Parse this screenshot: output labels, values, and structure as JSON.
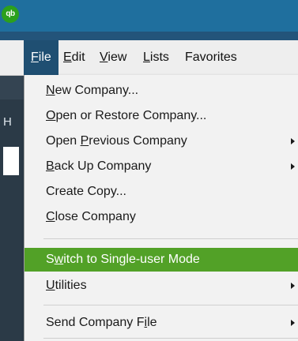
{
  "app": {
    "logo_text": "qb",
    "brand_color": "#2ca01c"
  },
  "menubar": {
    "items": [
      {
        "id": "file",
        "accel": "F",
        "rest": "ile",
        "active": true
      },
      {
        "id": "edit",
        "accel": "E",
        "rest": "dit"
      },
      {
        "id": "view",
        "accel": "V",
        "rest": "iew"
      },
      {
        "id": "lists",
        "accel": "L",
        "rest": "ists"
      },
      {
        "id": "favorites",
        "accel": "",
        "rest": "Favorites"
      }
    ]
  },
  "background": {
    "partial_letter": "H"
  },
  "file_menu": {
    "new_company": {
      "accel": "N",
      "rest": "ew Company..."
    },
    "open_restore": {
      "accel": "O",
      "rest": "pen or Restore Company..."
    },
    "open_previous": {
      "pre": "Open ",
      "accel": "P",
      "rest": "revious Company",
      "submenu": true
    },
    "back_up": {
      "accel": "B",
      "rest": "ack Up Company",
      "submenu": true
    },
    "create_copy": {
      "label": "Create Copy..."
    },
    "close_company": {
      "accel": "C",
      "rest": "lose Company"
    },
    "switch_mode": {
      "pre": "S",
      "accel": "w",
      "rest": "itch to Single-user Mode",
      "highlighted": true
    },
    "utilities": {
      "accel": "U",
      "rest": "tilities",
      "submenu": true
    },
    "send_company_file": {
      "pre": "Send Company F",
      "accel": "i",
      "rest": "le",
      "submenu": true
    },
    "highlight_color": "#52a127"
  }
}
